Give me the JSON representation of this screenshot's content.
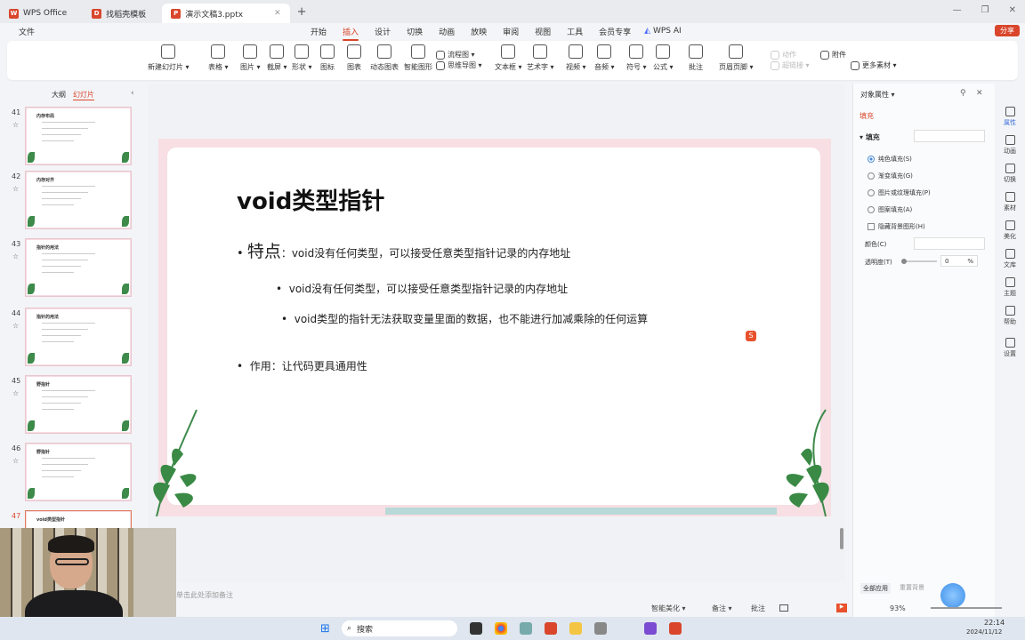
{
  "tabs": [
    {
      "label": "WPS Office",
      "color": "#d9462b",
      "icon": "wps-logo"
    },
    {
      "label": "找稻壳模板",
      "color": "#d9462b",
      "icon": "docer-logo"
    },
    {
      "label": "演示文稿3.pptx",
      "color": "#d9462b",
      "icon": "ppt-logo"
    }
  ],
  "menubar": {
    "file": "文件",
    "items": [
      "开始",
      "插入",
      "设计",
      "切换",
      "动画",
      "放映",
      "审阅",
      "视图",
      "工具",
      "会员专享"
    ],
    "active": "插入",
    "wps_ai": "WPS AI",
    "share": "分享"
  },
  "ribbon": [
    {
      "label": "新建幻灯片 ▾",
      "icon": "new-slide-icon"
    },
    {
      "label": "表格 ▾",
      "icon": "table-icon"
    },
    {
      "label": "图片 ▾",
      "icon": "picture-icon"
    },
    {
      "label": "截屏 ▾",
      "icon": "screenshot-icon"
    },
    {
      "label": "形状 ▾",
      "icon": "shape-icon"
    },
    {
      "label": "图标",
      "icon": "icons-icon"
    },
    {
      "label": "图表",
      "icon": "chart-icon"
    },
    {
      "label": "动态图表",
      "icon": "dynamic-chart-icon"
    },
    {
      "label": "智能图形",
      "icon": "smartart-icon"
    },
    {
      "label": "流程图 ▾",
      "icon": "flowchart-icon"
    },
    {
      "label": "思维导图 ▾",
      "icon": "mindmap-icon"
    },
    {
      "label": "文本框 ▾",
      "icon": "textbox-icon"
    },
    {
      "label": "艺术字 ▾",
      "icon": "wordart-icon"
    },
    {
      "label": "视频 ▾",
      "icon": "video-icon"
    },
    {
      "label": "音频 ▾",
      "icon": "audio-icon"
    },
    {
      "label": "符号 ▾",
      "icon": "symbol-icon"
    },
    {
      "label": "公式 ▾",
      "icon": "formula-icon"
    },
    {
      "label": "批注",
      "icon": "comment-icon"
    },
    {
      "label": "页眉页脚 ▾",
      "icon": "header-footer-icon"
    },
    {
      "label": "动作",
      "icon": "action-icon"
    },
    {
      "label": "超链接 ▾",
      "icon": "hyperlink-icon"
    },
    {
      "label": "附件",
      "icon": "attachment-icon"
    },
    {
      "label": "更多素材 ▾",
      "icon": "more-material-icon"
    }
  ],
  "leftpanel": {
    "tab_outline": "大纲",
    "tab_slides": "幻灯片",
    "slides": [
      {
        "num": "41",
        "title": "内存布局"
      },
      {
        "num": "42",
        "title": "内存对齐"
      },
      {
        "num": "43",
        "title": "指针的用法"
      },
      {
        "num": "44",
        "title": "指针的用法"
      },
      {
        "num": "45",
        "title": "野指针"
      },
      {
        "num": "46",
        "title": "野指针"
      },
      {
        "num": "47",
        "title": "void类型指针"
      }
    ]
  },
  "slide": {
    "title": "void类型指针",
    "bullet1_head": "特点",
    "bullet1_rest": "：void没有任何类型，可以接受任意类型指针记录的内存地址",
    "sub1": "void没有任何类型，可以接受任意类型指针记录的内存地址",
    "sub2": "void类型的指针无法获取变量里面的数据，也不能进行加减乘除的任何运算",
    "bullet2": "作用：让代码更具通用性",
    "accent": "#f2c9d1"
  },
  "rightpanel": {
    "title": "对象属性 ▾",
    "tab": "填充",
    "section": "填充",
    "options": [
      "纯色填充(S)",
      "渐变填充(G)",
      "图片或纹理填充(P)",
      "图案填充(A)"
    ],
    "hide_bg": "隐藏背景图形(H)",
    "color_label": "颜色(C)",
    "transparency_label": "透明度(T)",
    "transparency_value": "0",
    "transparency_unit": "%",
    "apply_all": "全部应用",
    "reset_bg": "重置背景"
  },
  "sidebar": [
    "属性",
    "动画",
    "切换",
    "素材",
    "美化",
    "文库",
    "主题",
    "帮助",
    "设置"
  ],
  "status": {
    "notes_placeholder": "单击此处添加备注",
    "beautify": "智能美化 ▾",
    "notes": "备注 ▾",
    "comment": "批注",
    "zoom": "93%"
  },
  "taskbar": {
    "search": "搜索",
    "time": "22:14",
    "date": "2024/11/12"
  }
}
